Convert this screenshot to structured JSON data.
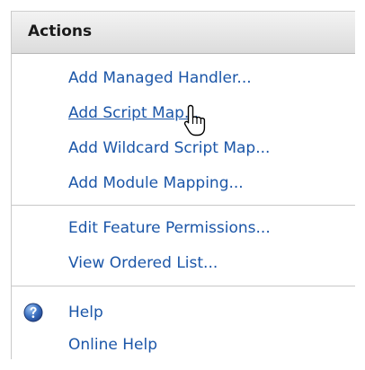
{
  "actions_panel": {
    "title": "Actions",
    "groups": [
      {
        "items": [
          {
            "label": "Add Managed Handler..."
          },
          {
            "label": "Add Script Map..."
          },
          {
            "label": "Add Wildcard Script Map..."
          },
          {
            "label": "Add Module Mapping..."
          }
        ]
      },
      {
        "items": [
          {
            "label": "Edit Feature Permissions..."
          },
          {
            "label": "View Ordered List..."
          }
        ]
      },
      {
        "items": [
          {
            "label": "Help",
            "icon": "help-icon"
          },
          {
            "label": "Online Help"
          }
        ]
      }
    ]
  },
  "cursor": {
    "icon": "hand-pointer-icon",
    "hovering": "Add Script Map..."
  },
  "colors": {
    "link": "#1b56a8",
    "header_top": "#f3f3f3",
    "header_bottom": "#dcdcdc",
    "divider": "#c8c8c8",
    "help_icon": "#2a5aa8"
  }
}
